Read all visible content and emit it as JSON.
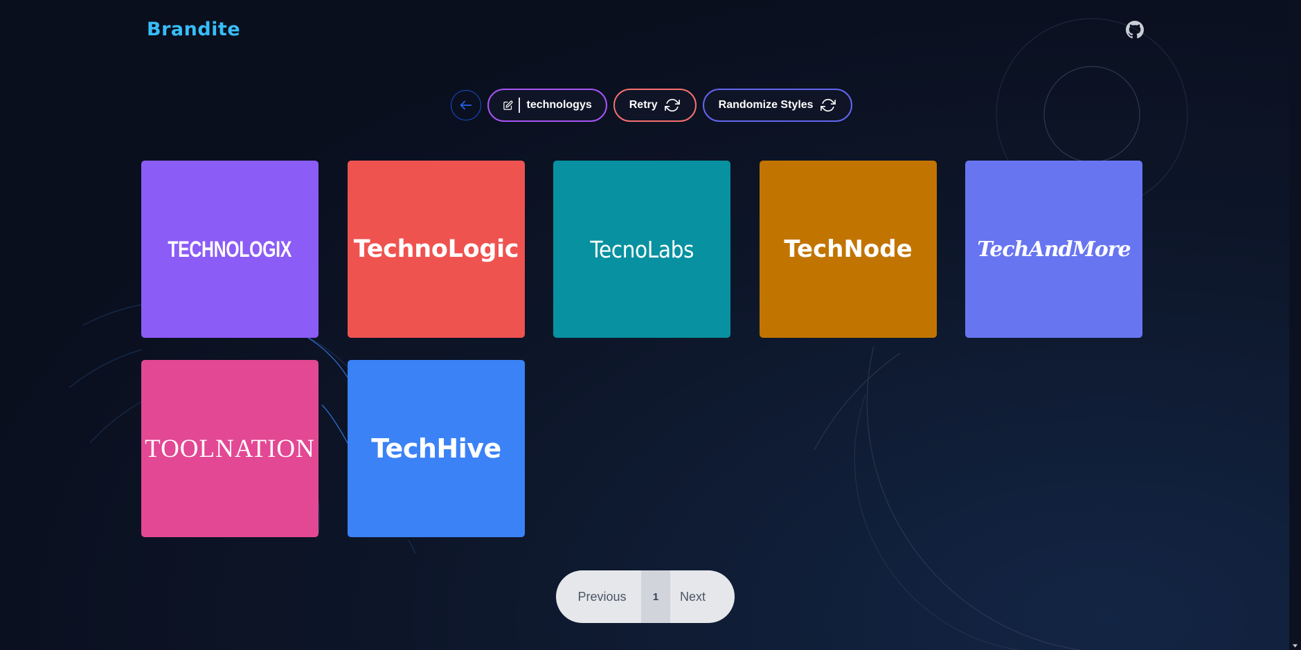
{
  "app": {
    "brand": "Brandite"
  },
  "icons": {
    "github": "github-icon",
    "back": "arrow-left-icon",
    "edit": "edit-icon",
    "refresh": "refresh-icon"
  },
  "toolbar": {
    "search_word": "technologys",
    "retry_label": "Retry",
    "randomize_label": "Randomize Styles"
  },
  "logos": [
    {
      "name": "TECHNOLOGIX",
      "color": "#8b5cf6"
    },
    {
      "name": "TechnoLogic",
      "color": "#ef5350"
    },
    {
      "name": "TecnoLabs",
      "color": "#0891a0"
    },
    {
      "name": "TechNode",
      "color": "#c27400"
    },
    {
      "name": "TechAndMore",
      "color": "#6875f1"
    },
    {
      "name": "TOOLNATION",
      "color": "#e34894"
    },
    {
      "name": "TechHive",
      "color": "#3b82f6"
    }
  ],
  "pagination": {
    "previous_label": "Previous",
    "current_page": "1",
    "next_label": "Next"
  },
  "colors": {
    "background": "#0b1120",
    "brand": "#38bdf8"
  }
}
